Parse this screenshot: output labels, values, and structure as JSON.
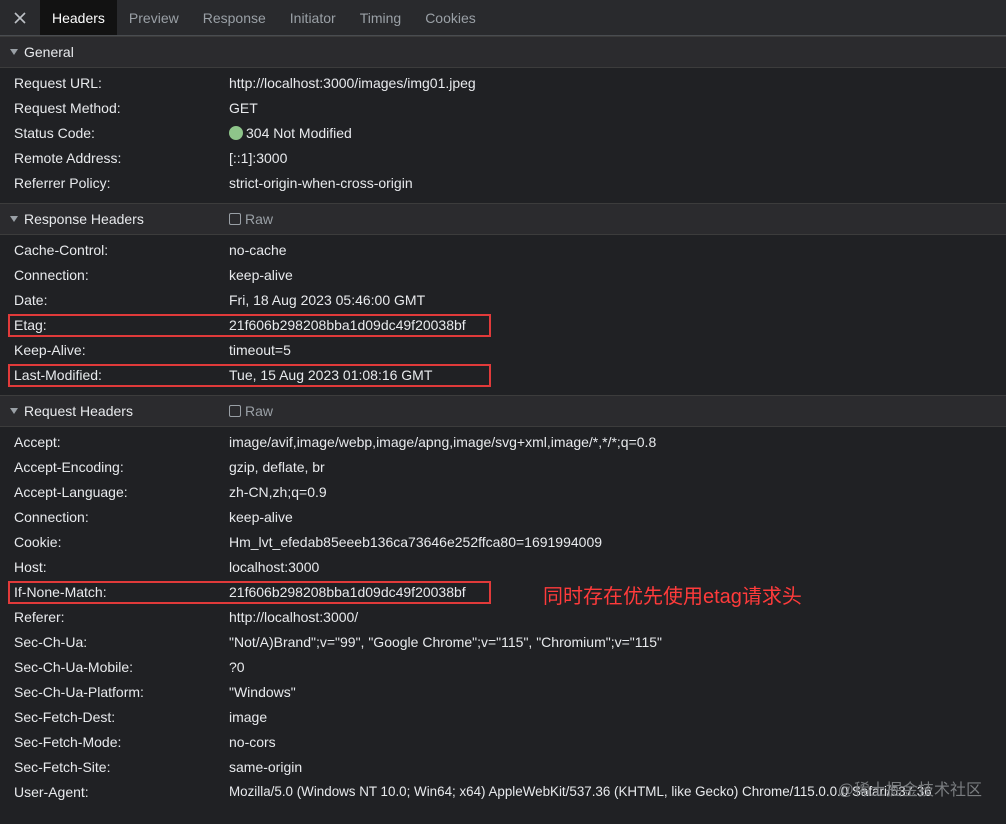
{
  "tabs": {
    "items": [
      {
        "label": "Headers",
        "active": true
      },
      {
        "label": "Preview"
      },
      {
        "label": "Response"
      },
      {
        "label": "Initiator"
      },
      {
        "label": "Timing"
      },
      {
        "label": "Cookies"
      }
    ]
  },
  "general": {
    "title": "General",
    "request_url": {
      "key": "Request URL:",
      "value": "http://localhost:3000/images/img01.jpeg"
    },
    "request_method": {
      "key": "Request Method:",
      "value": "GET"
    },
    "status_code": {
      "key": "Status Code:",
      "value": "304 Not Modified"
    },
    "remote_address": {
      "key": "Remote Address:",
      "value": "[::1]:3000"
    },
    "referrer_policy": {
      "key": "Referrer Policy:",
      "value": "strict-origin-when-cross-origin"
    }
  },
  "response_headers": {
    "title": "Response Headers",
    "raw_label": "Raw",
    "cache_control": {
      "key": "Cache-Control:",
      "value": "no-cache"
    },
    "connection": {
      "key": "Connection:",
      "value": "keep-alive"
    },
    "date": {
      "key": "Date:",
      "value": "Fri, 18 Aug 2023 05:46:00 GMT"
    },
    "etag": {
      "key": "Etag:",
      "value": "21f606b298208bba1d09dc49f20038bf"
    },
    "keep_alive": {
      "key": "Keep-Alive:",
      "value": "timeout=5"
    },
    "last_modified": {
      "key": "Last-Modified:",
      "value": "Tue, 15 Aug 2023 01:08:16 GMT"
    }
  },
  "request_headers": {
    "title": "Request Headers",
    "raw_label": "Raw",
    "accept": {
      "key": "Accept:",
      "value": "image/avif,image/webp,image/apng,image/svg+xml,image/*,*/*;q=0.8"
    },
    "accept_encoding": {
      "key": "Accept-Encoding:",
      "value": "gzip, deflate, br"
    },
    "accept_language": {
      "key": "Accept-Language:",
      "value": "zh-CN,zh;q=0.9"
    },
    "connection": {
      "key": "Connection:",
      "value": "keep-alive"
    },
    "cookie": {
      "key": "Cookie:",
      "value": "Hm_lvt_efedab85eeeb136ca73646e252ffca80=1691994009"
    },
    "host": {
      "key": "Host:",
      "value": "localhost:3000"
    },
    "if_none_match": {
      "key": "If-None-Match:",
      "value": "21f606b298208bba1d09dc49f20038bf"
    },
    "referer": {
      "key": "Referer:",
      "value": "http://localhost:3000/"
    },
    "sec_ch_ua": {
      "key": "Sec-Ch-Ua:",
      "value": "\"Not/A)Brand\";v=\"99\", \"Google Chrome\";v=\"115\", \"Chromium\";v=\"115\""
    },
    "sec_ch_ua_mobile": {
      "key": "Sec-Ch-Ua-Mobile:",
      "value": "?0"
    },
    "sec_ch_ua_platform": {
      "key": "Sec-Ch-Ua-Platform:",
      "value": "\"Windows\""
    },
    "sec_fetch_dest": {
      "key": "Sec-Fetch-Dest:",
      "value": "image"
    },
    "sec_fetch_mode": {
      "key": "Sec-Fetch-Mode:",
      "value": "no-cors"
    },
    "sec_fetch_site": {
      "key": "Sec-Fetch-Site:",
      "value": "same-origin"
    },
    "user_agent": {
      "key": "User-Agent:",
      "value": "Mozilla/5.0 (Windows NT 10.0; Win64; x64) AppleWebKit/537.36 (KHTML, like Gecko) Chrome/115.0.0.0 Safari/537.36"
    }
  },
  "annotation": "同时存在优先使用etag请求头",
  "watermark": "@稀土掘金技术社区",
  "colors": {
    "highlight": "#e13a3a",
    "annotation": "#ff3b3b",
    "status_ok": "#8ec58a"
  },
  "icons": {
    "close": "close-icon",
    "collapse": "triangle-down-icon",
    "raw": "checkbox-icon",
    "status": "status-dot-icon"
  }
}
